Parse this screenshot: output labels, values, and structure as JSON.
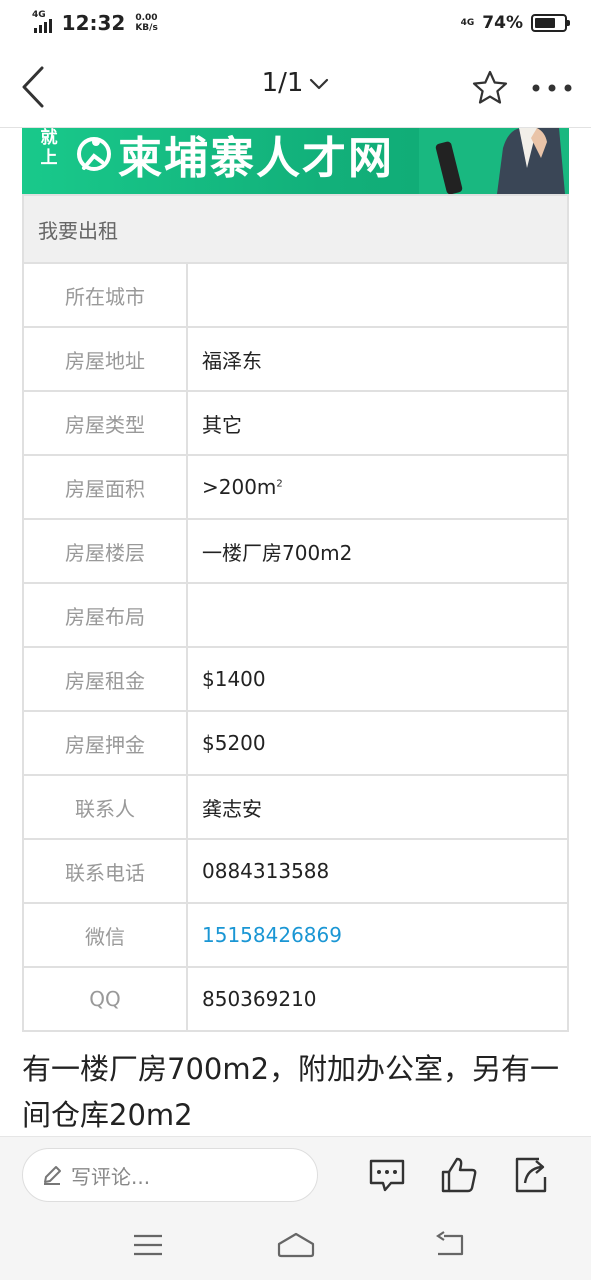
{
  "status_bar": {
    "network": "4G",
    "time": "12:32",
    "speed_value": "0.00",
    "speed_unit": "KB/s",
    "network_right": "4G",
    "battery": "74%"
  },
  "nav": {
    "page_indicator": "1/1",
    "icons": [
      "back-arrow-icon",
      "chevron-down-icon",
      "star-icon",
      "more-icon"
    ]
  },
  "banner": {
    "prefix": "就上",
    "text": "柬埔寨人才网",
    "color": "#15bf83"
  },
  "listing": {
    "header": "我要出租",
    "rows": [
      {
        "label": "所在城市",
        "value": ""
      },
      {
        "label": "房屋地址",
        "value": "福泽东"
      },
      {
        "label": "房屋类型",
        "value": "其它"
      },
      {
        "label": "房屋面积",
        "value": ">200m",
        "sup": "2"
      },
      {
        "label": "房屋楼层",
        "value": "一楼厂房700m2"
      },
      {
        "label": "房屋布局",
        "value": ""
      },
      {
        "label": "房屋租金",
        "value": "$1400"
      },
      {
        "label": "房屋押金",
        "value": "$5200"
      },
      {
        "label": "联系人",
        "value": "龚志安"
      },
      {
        "label": "联系电话",
        "value": "0884313588"
      },
      {
        "label": "微信",
        "value": "15158426869"
      },
      {
        "label": "QQ",
        "value": "850369210"
      }
    ],
    "link_color": "#1a96d4"
  },
  "description": "有一楼厂房700m2，附加办公室，另有一间仓库20m2",
  "comment_bar": {
    "placeholder": "写评论...",
    "icons": [
      "pencil-icon",
      "comment-icon",
      "like-icon",
      "share-icon"
    ]
  },
  "system_nav": {
    "icons": [
      "menu-icon",
      "home-icon",
      "back-icon"
    ]
  }
}
